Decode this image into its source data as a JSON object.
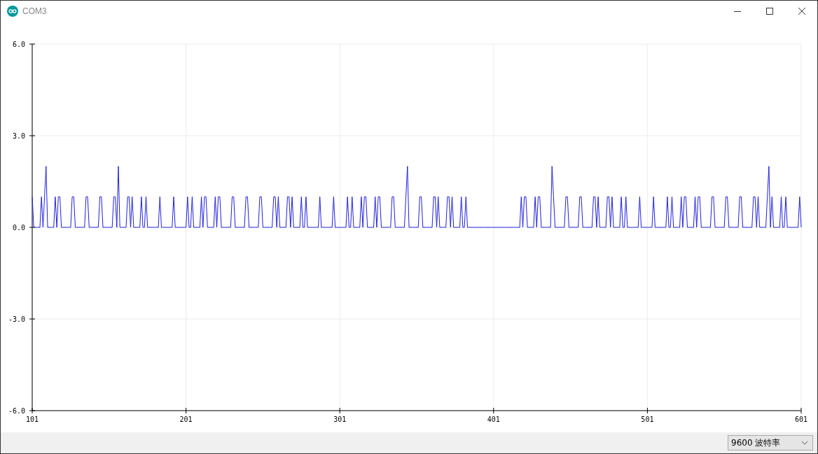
{
  "window": {
    "title": "COM3"
  },
  "plot": {
    "y_ticks": [
      "6.0",
      "3.0",
      "0.0",
      "-3.0",
      "-6.0"
    ],
    "x_ticks": [
      "101",
      "201",
      "301",
      "401",
      "501",
      "601"
    ]
  },
  "status_bar": {
    "baud_rate": "9600 波特率"
  }
}
